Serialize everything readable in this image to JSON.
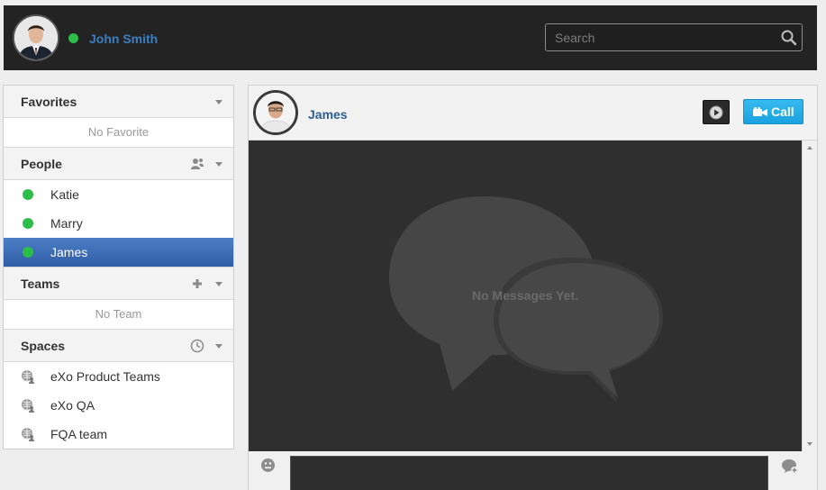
{
  "user": {
    "name": "John Smith",
    "status_color": "#2dbd4a"
  },
  "search": {
    "placeholder": "Search"
  },
  "sidebar": {
    "favorites": {
      "title": "Favorites",
      "empty": "No Favorite"
    },
    "people": {
      "title": "People",
      "items": [
        {
          "label": "Katie",
          "active": false
        },
        {
          "label": "Marry",
          "active": false
        },
        {
          "label": "James",
          "active": true
        }
      ]
    },
    "teams": {
      "title": "Teams",
      "empty": "No Team"
    },
    "spaces": {
      "title": "Spaces",
      "items": [
        {
          "label": "eXo Product Teams"
        },
        {
          "label": "eXo QA"
        },
        {
          "label": "FQA team"
        }
      ]
    }
  },
  "chat": {
    "contact_name": "James",
    "call_label": "Call",
    "empty_message": "No Messages Yet."
  },
  "colors": {
    "header_bg": "#232323",
    "accent_blue": "#3a69b3",
    "call_button": "#1aa3e0",
    "online": "#2dbd4a"
  }
}
